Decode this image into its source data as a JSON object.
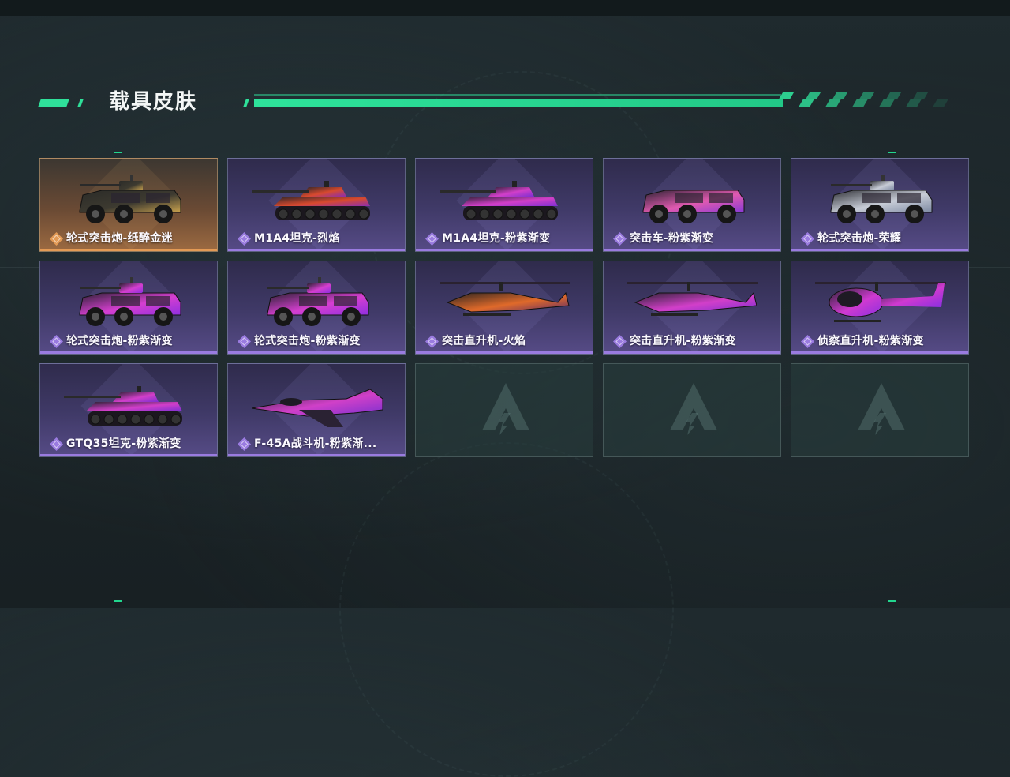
{
  "header": {
    "title": "载具皮肤"
  },
  "colors": {
    "accent": "#2fe09a",
    "purple_rarity": "#9a7be0",
    "gold_rarity": "#e39a55"
  },
  "skins": [
    {
      "name": "轮式突击炮-纸醉金迷",
      "rarity": "gold",
      "vehicle": "wheeled-assault-gun-icon",
      "palette": [
        "#2b2b28",
        "#3d3a30",
        "#c9a24e"
      ]
    },
    {
      "name": "M1A4坦克-烈焰",
      "rarity": "purple",
      "vehicle": "tank-icon",
      "palette": [
        "#2a2527",
        "#d84a2e",
        "#8a2db0"
      ]
    },
    {
      "name": "M1A4坦克-粉紫渐变",
      "rarity": "purple",
      "vehicle": "tank-icon",
      "palette": [
        "#2c2233",
        "#d23fc9",
        "#7d2fd1"
      ]
    },
    {
      "name": "突击车-粉紫渐变",
      "rarity": "purple",
      "vehicle": "assault-car-icon",
      "palette": [
        "#2b2230",
        "#e05ab0",
        "#8a3ad6"
      ]
    },
    {
      "name": "轮式突击炮-荣耀",
      "rarity": "purple",
      "vehicle": "wheeled-assault-gun-icon",
      "palette": [
        "#2f3036",
        "#c7ccd6",
        "#7e8aa3"
      ]
    },
    {
      "name": "轮式突击炮-粉紫渐变",
      "rarity": "purple",
      "vehicle": "wheeled-assault-gun-icon",
      "palette": [
        "#2a2131",
        "#d53fd0",
        "#8f2fe0"
      ]
    },
    {
      "name": "轮式突击炮-粉紫渐变",
      "rarity": "purple",
      "vehicle": "wheeled-assault-gun-icon",
      "palette": [
        "#2a2131",
        "#d53fd0",
        "#8f2fe0"
      ]
    },
    {
      "name": "突击直升机-火焰",
      "rarity": "purple",
      "vehicle": "attack-helicopter-icon",
      "palette": [
        "#2b2420",
        "#e06a2a",
        "#5a2a6a"
      ]
    },
    {
      "name": "突击直升机-粉紫渐变",
      "rarity": "purple",
      "vehicle": "attack-helicopter-icon",
      "palette": [
        "#2b2232",
        "#d23fc9",
        "#7d2fd1"
      ]
    },
    {
      "name": "侦察直升机-粉紫渐变",
      "rarity": "purple",
      "vehicle": "scout-helicopter-icon",
      "palette": [
        "#2b2232",
        "#cf3ad0",
        "#8a2fe0"
      ]
    },
    {
      "name": "GTQ35坦克-粉紫渐变",
      "rarity": "purple",
      "vehicle": "tank-icon",
      "palette": [
        "#2c2233",
        "#d23fc9",
        "#7d2fd1"
      ]
    },
    {
      "name": "F-45A战斗机-粉紫渐...",
      "rarity": "purple",
      "vehicle": "fighter-jet-icon",
      "palette": [
        "#2a2233",
        "#d040c8",
        "#7a30d0"
      ]
    }
  ],
  "empty_slots": 3,
  "empty_icon": "game-logo-icon"
}
